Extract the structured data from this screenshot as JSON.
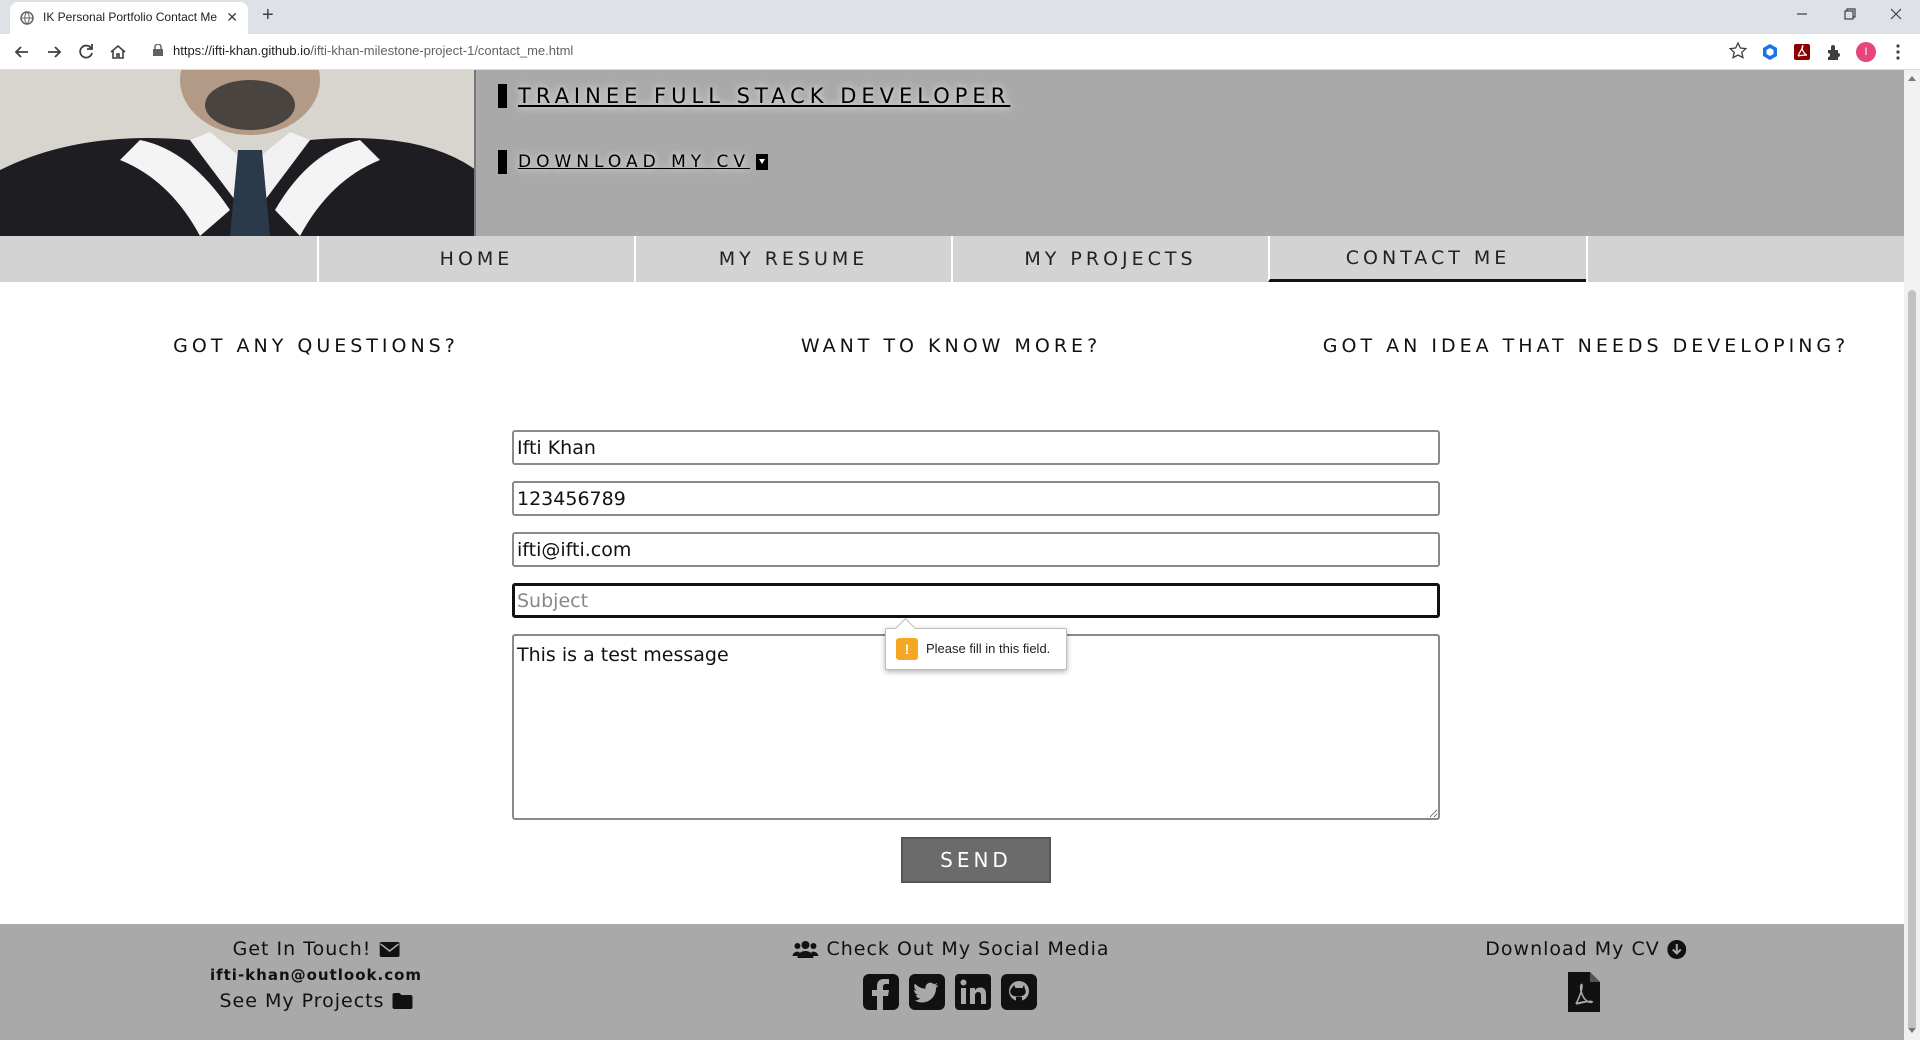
{
  "browser": {
    "tab_title": "IK Personal Portfolio Contact Me",
    "tab_close": "✕",
    "new_tab": "+",
    "url_host": "https://ifti-khan.github.io",
    "url_path": "/ifti-khan-milestone-project-1/contact_me.html",
    "profile_initial": "I"
  },
  "hero": {
    "title": "TRAINEE FULL STACK DEVELOPER",
    "cv_link": "DOWNLOAD MY CV"
  },
  "nav": {
    "items": [
      {
        "label": "HOME"
      },
      {
        "label": "MY RESUME"
      },
      {
        "label": "MY PROJECTS"
      },
      {
        "label": "CONTACT ME",
        "active": true
      }
    ]
  },
  "taglines": [
    "GOT ANY QUESTIONS?",
    "WANT TO KNOW MORE?",
    "GOT AN IDEA THAT NEEDS DEVELOPING?"
  ],
  "form": {
    "name_value": "Ifti Khan",
    "phone_value": "123456789",
    "email_value": "ifti@ifti.com",
    "subject_placeholder": "Subject",
    "message_value": "This is a test message",
    "validation_message": "Please fill in this field.",
    "send_label": "SEND"
  },
  "footer": {
    "get_in_touch": "Get In Touch!",
    "email": "ifti-khan@outlook.com",
    "see_projects": "See My Projects",
    "social_heading": "Check Out My Social Media",
    "download_cv": "Download My CV"
  },
  "colors": {
    "hero_bg": "#a9a9a9",
    "nav_bg": "#d3d3d3",
    "send_bg": "#6b6b6b",
    "warning": "#f5a623"
  }
}
